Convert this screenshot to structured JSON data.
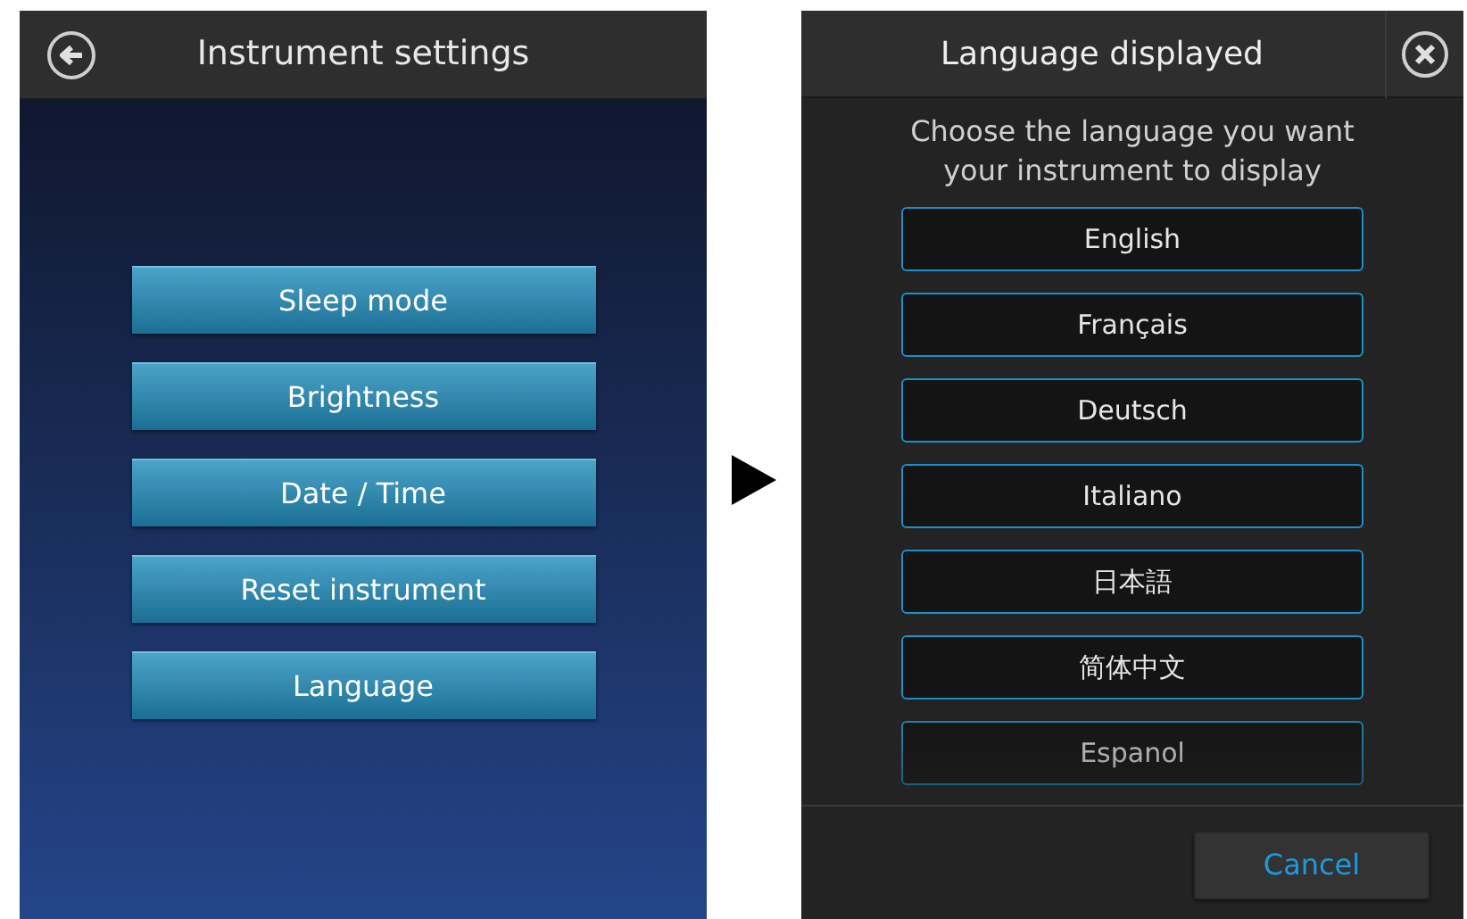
{
  "settings_screen": {
    "title": "Instrument settings",
    "menu": [
      {
        "label": "Sleep mode"
      },
      {
        "label": "Brightness"
      },
      {
        "label": "Date / Time"
      },
      {
        "label": "Reset instrument"
      },
      {
        "label": "Language"
      }
    ]
  },
  "language_screen": {
    "title": "Language displayed",
    "prompt": "Choose the language you want your instrument to display",
    "languages": [
      {
        "label": "English"
      },
      {
        "label": "Français"
      },
      {
        "label": "Deutsch"
      },
      {
        "label": "Italiano"
      },
      {
        "label": "日本語"
      },
      {
        "label": "简体中文"
      },
      {
        "label": "Espanol"
      }
    ],
    "cancel": "Cancel"
  }
}
